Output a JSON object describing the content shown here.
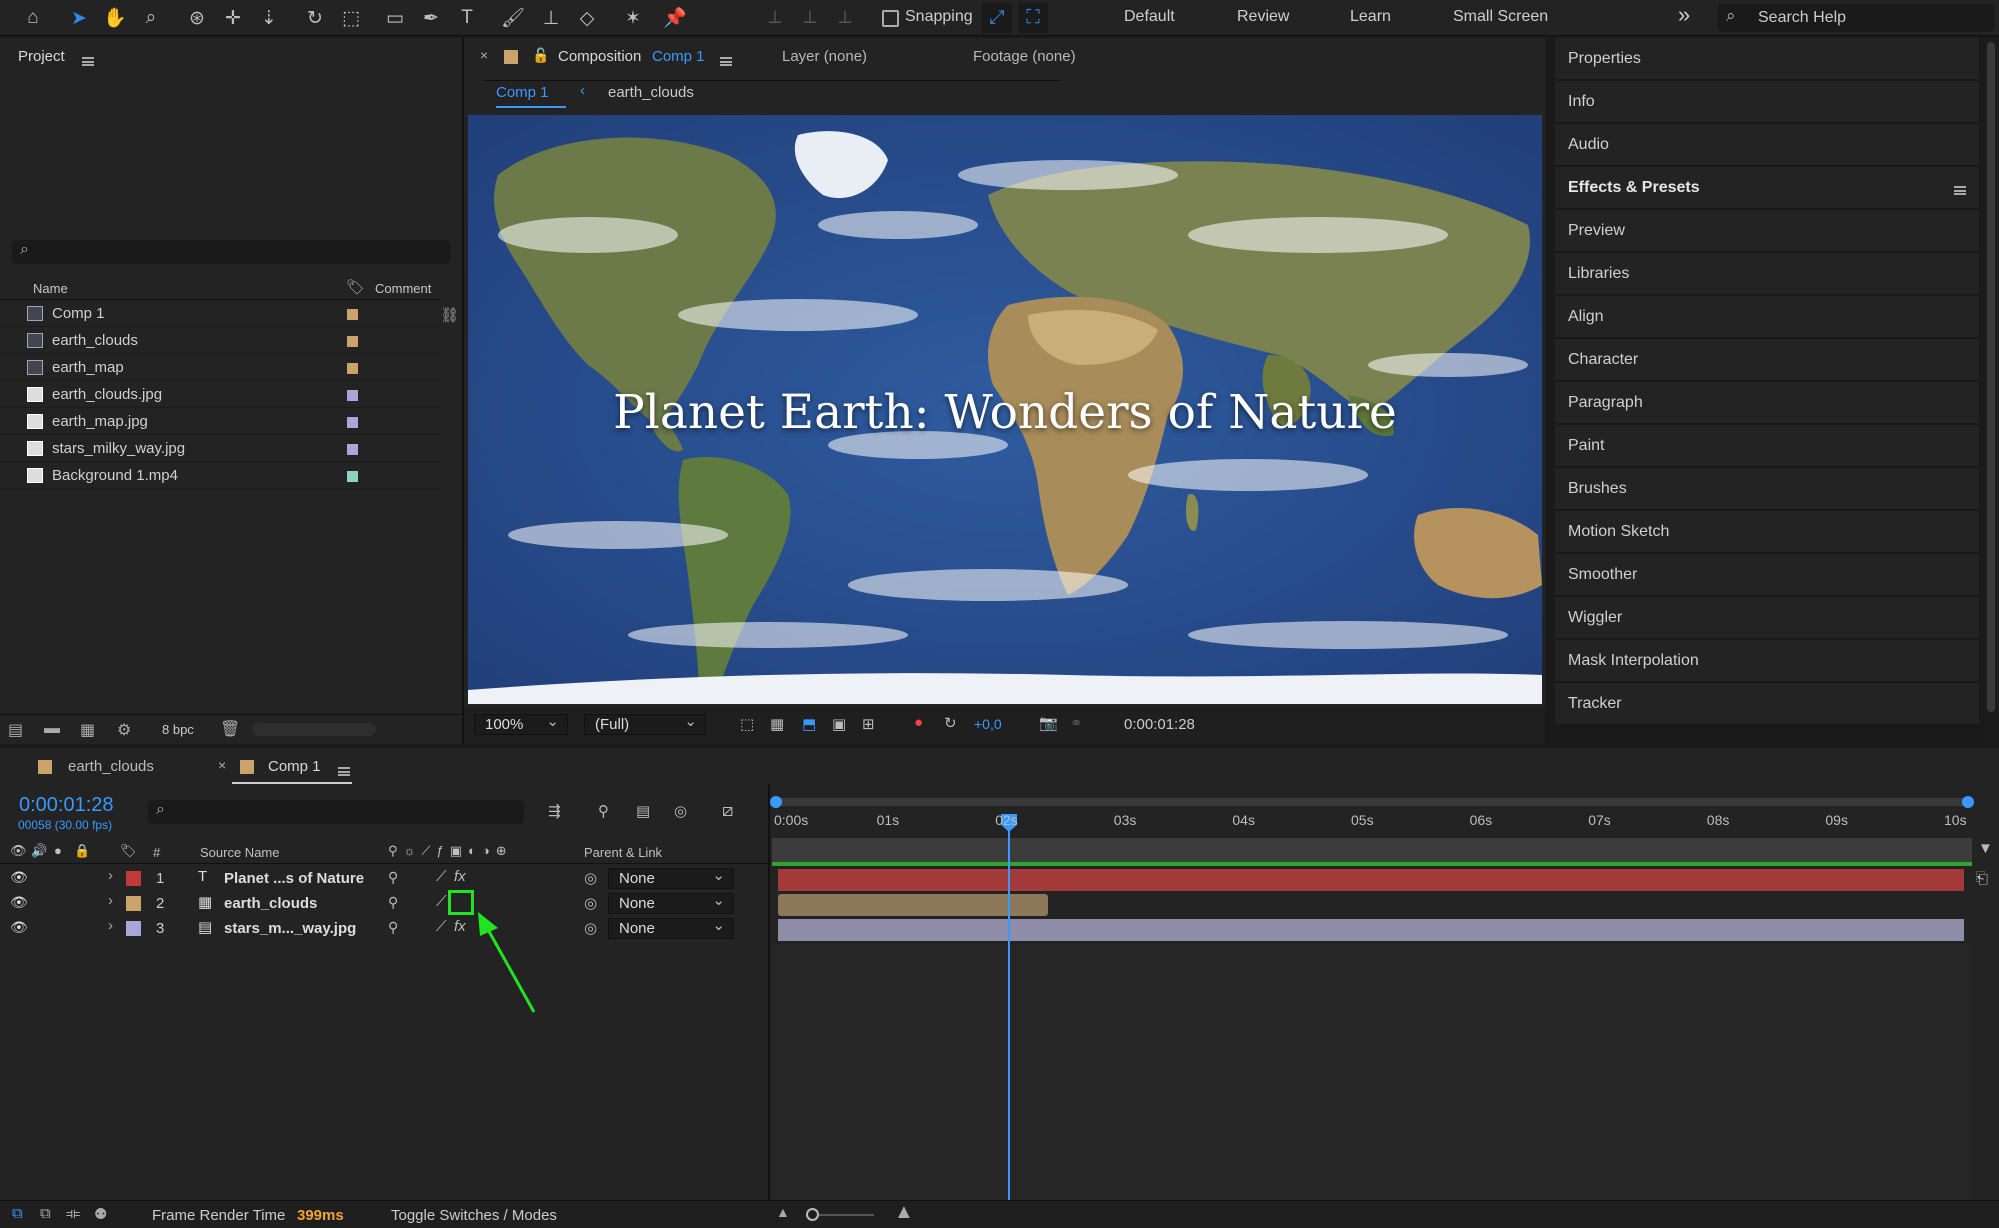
{
  "toolbar": {
    "snapping_label": "Snapping",
    "workspaces": [
      "Default",
      "Review",
      "Learn",
      "Small Screen"
    ],
    "more": "»",
    "search_placeholder": "Search Help"
  },
  "project": {
    "title": "Project",
    "col_name": "Name",
    "col_comment": "Comment",
    "items": [
      {
        "name": "Comp 1",
        "type": "comp",
        "label_color": "#c9a36a"
      },
      {
        "name": "earth_clouds",
        "type": "comp",
        "label_color": "#c9a36a"
      },
      {
        "name": "earth_map",
        "type": "comp",
        "label_color": "#c9a36a"
      },
      {
        "name": "earth_clouds.jpg",
        "type": "file",
        "label_color": "#a9a6d9"
      },
      {
        "name": "earth_map.jpg",
        "type": "file",
        "label_color": "#a9a6d9"
      },
      {
        "name": "stars_milky_way.jpg",
        "type": "file",
        "label_color": "#a9a6d9"
      },
      {
        "name": "Background 1.mp4",
        "type": "video",
        "label_color": "#8fd1c0"
      }
    ],
    "bpc": "8 bpc"
  },
  "composition": {
    "tab_prefix": "Composition",
    "tab_name": "Comp 1",
    "layer_tab": "Layer (none)",
    "footage_tab": "Footage (none)",
    "breadcrumb_active": "Comp 1",
    "breadcrumb_next": "earth_clouds",
    "title_text": "Planet Earth: Wonders of Nature",
    "zoom": "100%",
    "resolution": "(Full)",
    "exposure": "+0,0",
    "timecode": "0:00:01:28"
  },
  "right_panels": [
    "Properties",
    "Info",
    "Audio",
    "Effects & Presets",
    "Preview",
    "Libraries",
    "Align",
    "Character",
    "Paragraph",
    "Paint",
    "Brushes",
    "Motion Sketch",
    "Smoother",
    "Wiggler",
    "Mask Interpolation",
    "Tracker"
  ],
  "timeline": {
    "tab1": "earth_clouds",
    "tab2": "Comp 1",
    "timecode": "0:00:01:28",
    "frames": "00058 (30.00 fps)",
    "col_num": "#",
    "col_source": "Source Name",
    "col_parent": "Parent & Link",
    "ticks": [
      "0:00s",
      "01s",
      "02s",
      "03s",
      "04s",
      "05s",
      "06s",
      "07s",
      "08s",
      "09s",
      "10s"
    ],
    "layers": [
      {
        "num": "1",
        "name": "Planet ...s of Nature",
        "type": "T",
        "color": "#c13a3a",
        "parent": "None"
      },
      {
        "num": "2",
        "name": "earth_clouds",
        "type": "comp",
        "color": "#c9a36a",
        "parent": "None"
      },
      {
        "num": "3",
        "name": "stars_m..._way.jpg",
        "type": "file",
        "color": "#a9a6d9",
        "parent": "None"
      }
    ]
  },
  "status": {
    "frame_render_label": "Frame Render Time",
    "frame_render_value": "399ms",
    "toggle": "Toggle Switches / Modes"
  }
}
